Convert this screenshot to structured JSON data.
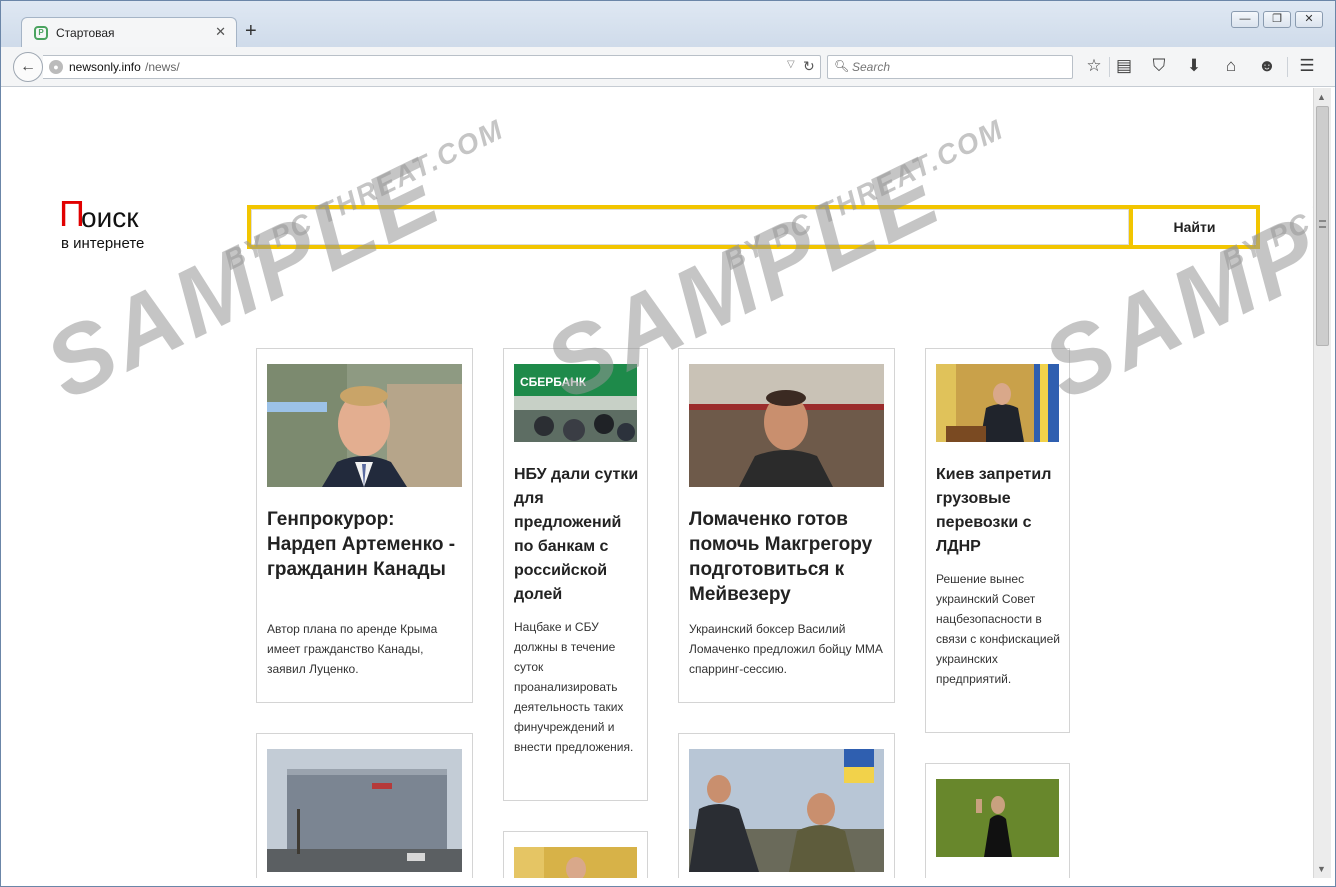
{
  "browser": {
    "tab_title": "Стартовая",
    "new_tab_symbol": "+",
    "tab_close_symbol": "✕",
    "window_controls": {
      "minimize": "—",
      "maximize": "❐",
      "close": "✕"
    },
    "address": {
      "host": "newsonly.info",
      "path": "/news/"
    },
    "search_placeholder": "Search"
  },
  "page": {
    "logo_first_letter": "П",
    "logo_rest": "оиск",
    "logo_sub": "в интернете",
    "search_button": "Найти"
  },
  "articles": [
    {
      "title": "Генпрокурор: Нардеп Артеменко - гражданин Канады",
      "summary": "Автор плана по аренде Крыма имеет гражданство Канады, заявил Луценко."
    },
    {
      "title": "НБУ дали сутки для предложений по банкам с российской долей",
      "summary": "Нацбаке и СБУ должны в течение суток проанализировать деятельность таких финучреждений и внести предложения.",
      "image_text": "СБЕРБАНК"
    },
    {
      "title": "Ломаченко готов помочь Макгрегору подготовиться к Мейвезеру",
      "summary": "Украинский боксер Василий Ломаченко предложил бойцу ММА спарринг-сессию."
    },
    {
      "title": "Киев запретил грузовые перевозки с ЛДНР",
      "summary": "Решение вынес украинский Совет нацбезопасности в связи с конфискацией украинских предприятий."
    }
  ],
  "watermark": {
    "big": "SAMPLE",
    "small": "BY PC THREAT.COM"
  },
  "colors": {
    "accent_yellow": "#f2c500",
    "logo_red": "#e10000",
    "window_frame": "#6b86a8"
  },
  "icons": [
    "back-arrow-icon",
    "globe-icon",
    "dropdown-icon",
    "reload-icon",
    "search-icon",
    "bookmark-star-icon",
    "reading-list-icon",
    "pocket-icon",
    "download-icon",
    "home-icon",
    "smiley-icon",
    "hamburger-menu-icon"
  ]
}
